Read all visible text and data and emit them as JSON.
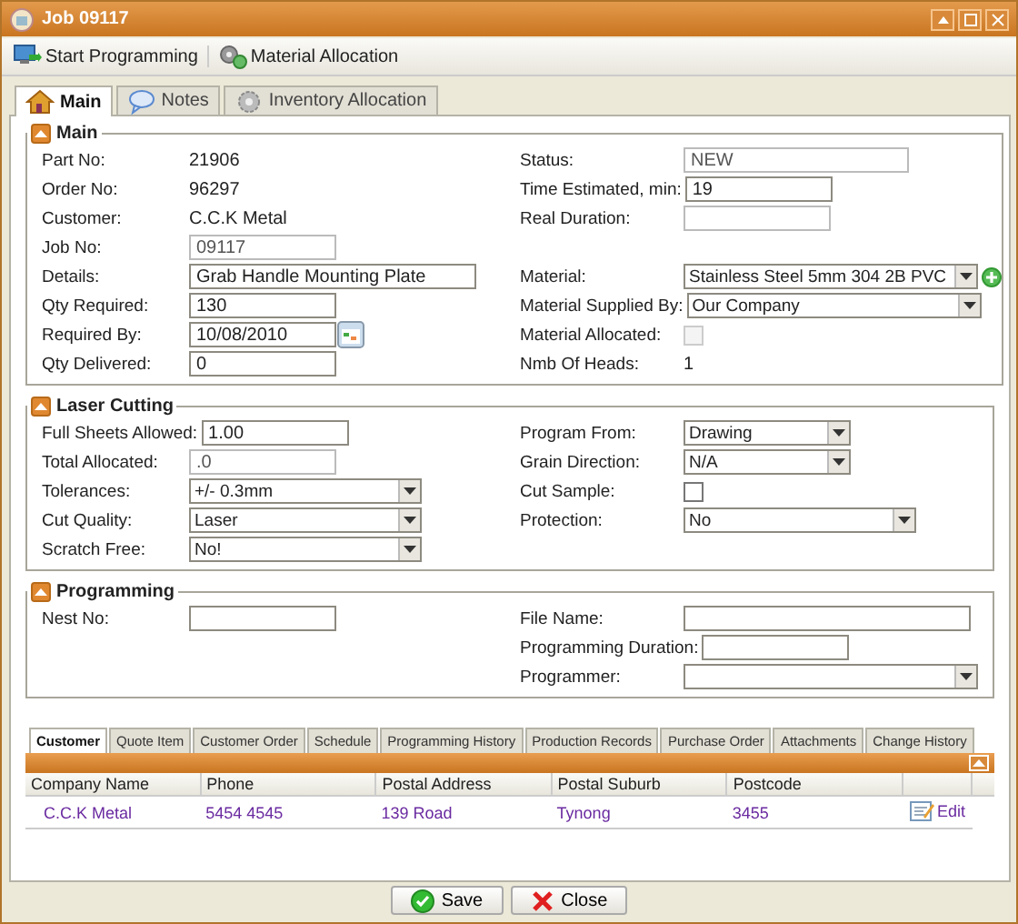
{
  "window": {
    "title": "Job 09117"
  },
  "toolbar": [
    {
      "label": "Start Programming"
    },
    {
      "label": "Material Allocation"
    }
  ],
  "tabs": [
    {
      "label": "Main",
      "selected": true
    },
    {
      "label": "Notes",
      "selected": false
    },
    {
      "label": "Inventory Allocation",
      "selected": false
    }
  ],
  "sections": [
    {
      "title": "Main",
      "rows": [
        {
          "left": {
            "label": "Part No:",
            "kind": "text",
            "value": "21906"
          },
          "right": {
            "label": "Status:",
            "kind": "input",
            "value": "NEW",
            "readonly": true
          }
        },
        {
          "left": {
            "label": "Order No:",
            "kind": "text",
            "value": "96297"
          },
          "right": {
            "label": "Time Estimated, min:",
            "kind": "input",
            "value": "19"
          }
        },
        {
          "left": {
            "label": "Customer:",
            "kind": "text",
            "value": "C.C.K Metal"
          },
          "right": {
            "label": "Real Duration:",
            "kind": "input",
            "readonly": true
          }
        },
        {
          "left": {
            "label": "Job No:",
            "kind": "input",
            "value": "09117",
            "readonly": true
          }
        },
        {
          "left": {
            "label": "Details:",
            "kind": "input",
            "value": "Grab Handle Mounting Plate"
          },
          "right": {
            "label": "Material:",
            "kind": "select",
            "value": "Stainless Steel 5mm 304 2B PVC",
            "add": true
          }
        },
        {
          "left": {
            "label": "Qty Required:",
            "kind": "input",
            "value": "130"
          },
          "right": {
            "label": "Material Supplied By:",
            "kind": "select",
            "value": "Our Company"
          }
        },
        {
          "left": {
            "label": "Required By:",
            "kind": "date",
            "value": "10/08/2010"
          },
          "right": {
            "label": "Material Allocated:",
            "kind": "checkbox",
            "checked": false,
            "disabled": true
          }
        },
        {
          "left": {
            "label": "Qty Delivered:",
            "kind": "input",
            "value": "0"
          },
          "right": {
            "label": "Nmb Of Heads:",
            "kind": "text",
            "value": "1"
          }
        }
      ]
    },
    {
      "title": "Laser Cutting",
      "rows": [
        {
          "left": {
            "label": "Full Sheets Allowed:",
            "kind": "input",
            "value": "1.00"
          },
          "right": {
            "label": "Program From:",
            "kind": "select",
            "value": "Drawing"
          }
        },
        {
          "left": {
            "label": "Total Allocated:",
            "kind": "input",
            "value": ".0",
            "readonly": true
          },
          "right": {
            "label": "Grain Direction:",
            "kind": "select",
            "value": "N/A"
          }
        },
        {
          "left": {
            "label": "Tolerances:",
            "kind": "select",
            "value": "+/- 0.3mm"
          },
          "right": {
            "label": "Cut Sample:",
            "kind": "checkbox",
            "checked": false,
            "disabled": false
          }
        },
        {
          "left": {
            "label": "Cut Quality:",
            "kind": "select",
            "value": "Laser"
          },
          "right": {
            "label": "Protection:",
            "kind": "select",
            "value": "No"
          }
        },
        {
          "left": {
            "label": "Scratch Free:",
            "kind": "select",
            "value": "No!"
          }
        }
      ]
    },
    {
      "title": "Programming",
      "rows": [
        {
          "left": {
            "label": "Nest No:",
            "kind": "input"
          },
          "right": {
            "label": "File Name:",
            "kind": "input"
          }
        },
        {
          "right": {
            "label": "Programming Duration:",
            "kind": "input"
          }
        },
        {
          "right": {
            "label": "Programmer:",
            "kind": "select"
          }
        }
      ]
    }
  ],
  "bottom_tabs": [
    {
      "label": "Customer",
      "selected": true
    },
    {
      "label": "Quote Item",
      "selected": false
    },
    {
      "label": "Customer Order",
      "selected": false
    },
    {
      "label": "Schedule",
      "selected": false
    },
    {
      "label": "Programming History",
      "selected": false
    },
    {
      "label": "Production Records",
      "selected": false
    },
    {
      "label": "Purchase Order",
      "selected": false
    },
    {
      "label": "Attachments",
      "selected": false
    },
    {
      "label": "Change History",
      "selected": false
    }
  ],
  "grid": {
    "columns": [
      "Company Name",
      "Phone",
      "Postal Address",
      "Postal Suburb",
      "Postcode"
    ],
    "rows": [
      {
        "cells": [
          "C.C.K Metal",
          "5454 4545",
          "139 Road",
          "Tynong",
          "3455"
        ],
        "action": "Edit"
      }
    ]
  },
  "buttons": [
    {
      "label": "Save",
      "kind": "save"
    },
    {
      "label": "Close",
      "kind": "close"
    }
  ]
}
